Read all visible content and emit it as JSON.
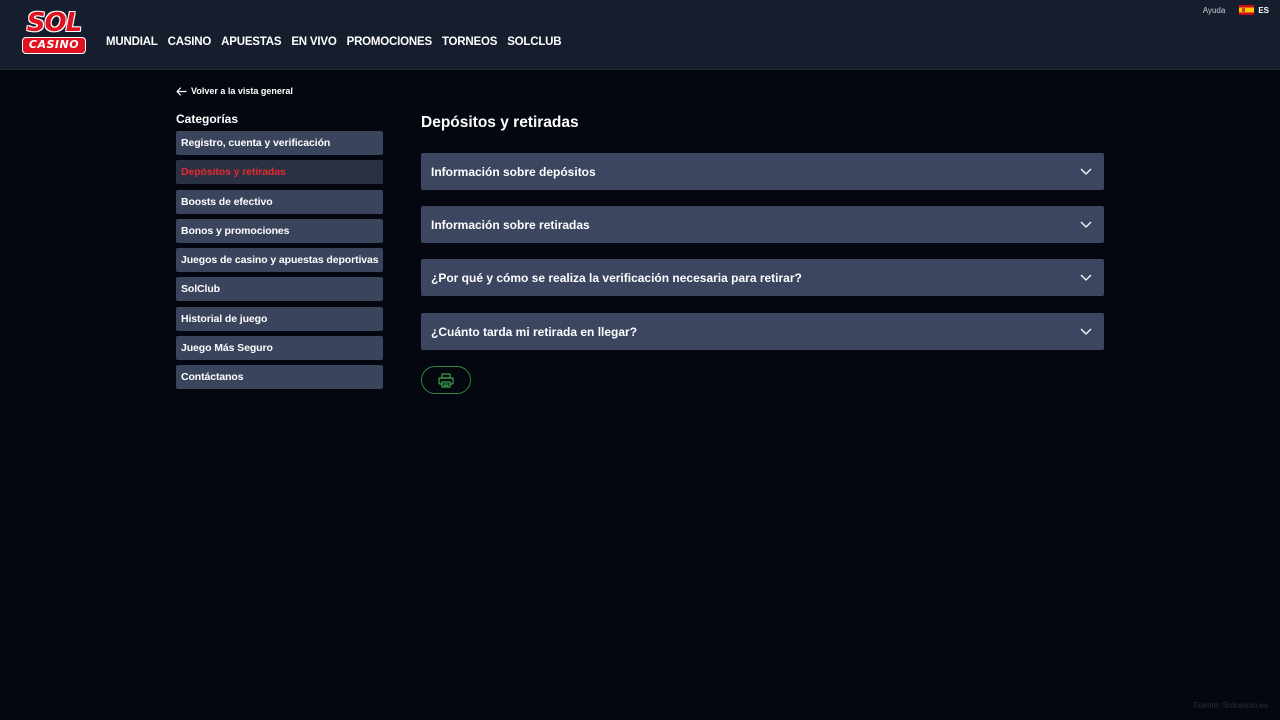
{
  "brand": {
    "logo_top": "SOL",
    "logo_bottom": "CASINO",
    "red": "#e1121f"
  },
  "header": {
    "nav": [
      "MUNDIAL",
      "CASINO",
      "APUESTAS",
      "EN VIVO",
      "PROMOCIONES",
      "TORNEOS",
      "SOLCLUB"
    ],
    "help_label": "Ayuda",
    "language": "ES"
  },
  "back_link": {
    "label": "Volver a la vista general",
    "icon": "arrow-left-icon"
  },
  "sidebar": {
    "title": "Categorías",
    "items": [
      {
        "label": "Registro, cuenta y verificación",
        "active": false
      },
      {
        "label": "Depósitos y retiradas",
        "active": true
      },
      {
        "label": "Boosts de efectivo",
        "active": false
      },
      {
        "label": "Bonos y promociones",
        "active": false
      },
      {
        "label": "Juegos de casino y apuestas deportivas",
        "active": false
      },
      {
        "label": "SolClub",
        "active": false
      },
      {
        "label": "Historial de juego",
        "active": false
      },
      {
        "label": "Juego Más Seguro",
        "active": false
      },
      {
        "label": "Contáctanos",
        "active": false
      }
    ]
  },
  "main": {
    "title": "Depósitos y retiradas",
    "faqs": [
      {
        "question": "Información sobre depósitos"
      },
      {
        "question": "Información sobre retiradas"
      },
      {
        "question": "¿Por qué y cómo se realiza la verificación necesaria para retirar?"
      },
      {
        "question": "¿Cuánto tarda mi retirada en llegar?"
      }
    ],
    "print_icon": "printer-icon"
  },
  "watermark": "Fuente: Solcasino.es",
  "colors": {
    "background": "#04070f",
    "header": "#161d2c",
    "sidebar_item": "#3a445c",
    "sidebar_active_text": "#e8282f",
    "accordion": "#3c4660",
    "print_border": "#2f8a3c"
  }
}
